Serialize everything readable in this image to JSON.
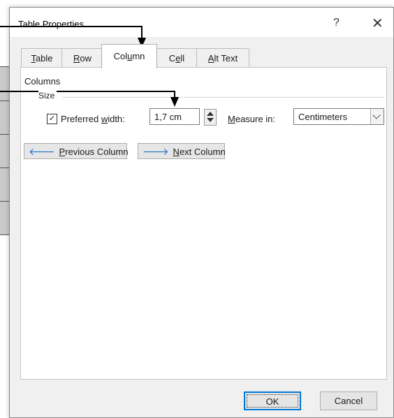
{
  "dialog": {
    "title": "Table Properties",
    "help_glyph": "?",
    "close_glyph": "✕"
  },
  "tabs": [
    {
      "pre": "",
      "key": "T",
      "post": "able"
    },
    {
      "pre": "",
      "key": "R",
      "post": "ow"
    },
    {
      "pre": "Col",
      "key": "u",
      "post": "mn"
    },
    {
      "pre": "C",
      "key": "e",
      "post": "ll"
    },
    {
      "pre": "",
      "key": "A",
      "post": "lt Text"
    }
  ],
  "active_tab": "Column",
  "columns_group": {
    "title": "Columns",
    "size_label": "Size",
    "preferred_width": {
      "checked": true,
      "check_glyph": "✓",
      "label_pre": "Preferred ",
      "label_key": "w",
      "label_post": "idth:",
      "value": "1,7 cm"
    },
    "measure_in": {
      "label_pre": "",
      "label_key": "M",
      "label_post": "easure in:",
      "value": "Centimeters"
    }
  },
  "nav": {
    "previous": {
      "pre": "",
      "key": "P",
      "post": "revious Column",
      "arrow": "🡐"
    },
    "next": {
      "pre": "",
      "key": "N",
      "post": "ext Column",
      "arrow": "🡒"
    }
  },
  "buttons": {
    "ok": "OK",
    "cancel": "Cancel"
  },
  "colors": {
    "accent": "#0078d7",
    "arrow_blue": "#1b6fc8"
  }
}
